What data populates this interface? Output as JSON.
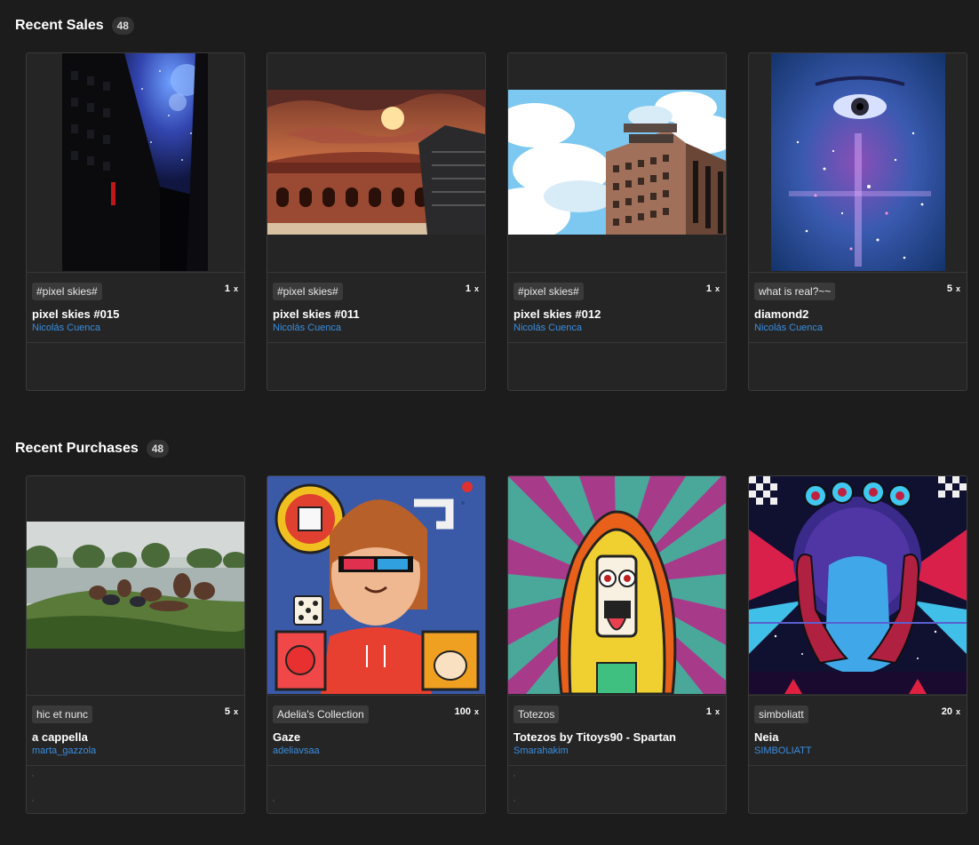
{
  "recent_sales": {
    "title": "Recent Sales",
    "count": "48",
    "items": [
      {
        "tag": "#pixel skies#",
        "edition": "1",
        "edition_suffix": "x",
        "title": "pixel skies #015",
        "creator": "Nicolás Cuenca"
      },
      {
        "tag": "#pixel skies#",
        "edition": "1",
        "edition_suffix": "x",
        "title": "pixel skies #011",
        "creator": "Nicolás Cuenca"
      },
      {
        "tag": "#pixel skies#",
        "edition": "1",
        "edition_suffix": "x",
        "title": "pixel skies #012",
        "creator": "Nicolás Cuenca"
      },
      {
        "tag": "what is real?~~",
        "edition": "5",
        "edition_suffix": "x",
        "title": "diamond2",
        "creator": "Nicolás Cuenca"
      }
    ]
  },
  "recent_purchases": {
    "title": "Recent Purchases",
    "count": "48",
    "items": [
      {
        "tag": "hic et nunc",
        "edition": "5",
        "edition_suffix": "x",
        "title": "a cappella",
        "creator": "marta_gazzola"
      },
      {
        "tag": "Adelia's Collection",
        "edition": "100",
        "edition_suffix": "x",
        "title": "Gaze",
        "creator": "adeliavsaa"
      },
      {
        "tag": "Totezos",
        "edition": "1",
        "edition_suffix": "x",
        "title": "Totezos by Titoys90 - Spartan",
        "creator": "Smarahakim"
      },
      {
        "tag": "simboliatt",
        "edition": "20",
        "edition_suffix": "x",
        "title": "Neia",
        "creator": "SIMBOLIATT"
      }
    ]
  },
  "colors": {
    "background": "#1c1c1c",
    "card": "#252525",
    "creator_link": "#3a8ee0",
    "tag_bg": "#3a3a3a"
  }
}
